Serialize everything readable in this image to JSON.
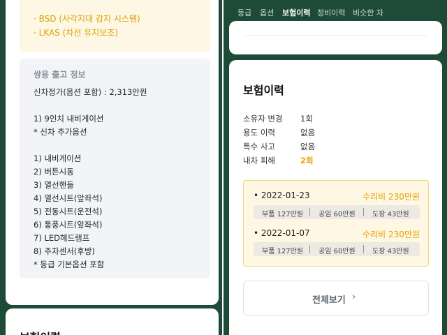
{
  "left": {
    "safety_options": [
      "· BSD (사각지대 감지 시스템)",
      "· LKAS (차선 유지보조)"
    ],
    "release_info": {
      "title": "쌍용 출고 정보",
      "lines": [
        "신차정가(옵션 포함) : 2,313만원",
        "1) 9인치 내비게이션",
        "* 신차 추가옵션",
        "1) 내비게이션",
        "2) 버튼시동",
        "3) 열선핸들",
        "4) 열선시트(앞좌석)",
        "5) 전동시트(운전석)",
        "6) 통풍시트(앞좌석)",
        "7) LED헤드램프",
        "8) 주차센서(후방)",
        "* 등급 기본옵션 포함"
      ]
    },
    "next_section_title": "보험이력"
  },
  "right": {
    "tabs": [
      {
        "label": "등급",
        "active": false
      },
      {
        "label": "옵션",
        "active": false
      },
      {
        "label": "보험이력",
        "active": true
      },
      {
        "label": "정비이력",
        "active": false
      },
      {
        "label": "비슷한 차",
        "active": false
      }
    ],
    "insurance": {
      "title": "보험이력",
      "rows": [
        {
          "label": "소유자 변경",
          "value": "1회"
        },
        {
          "label": "용도 이력",
          "value": "없음"
        },
        {
          "label": "특수 사고",
          "value": "없음"
        },
        {
          "label": "내차 피해",
          "value": "2회"
        }
      ],
      "accidents": [
        {
          "date": "• 2022-01-23",
          "cost": "수리비 230만원",
          "parts": "부품 127만원",
          "labor": "공임 60만원",
          "paint": "도장 43만원"
        },
        {
          "date": "• 2022-01-07",
          "cost": "수리비 230만원",
          "parts": "부품 127만원",
          "labor": "공임 60만원",
          "paint": "도장 43만원"
        }
      ],
      "view_all_label": "전체보기",
      "view_all_icon": "chevron-right-icon"
    }
  },
  "colors": {
    "brand_green": "#1e4a38",
    "highlight": "#e8a200",
    "yellow_bg": "#fdf7e3"
  }
}
